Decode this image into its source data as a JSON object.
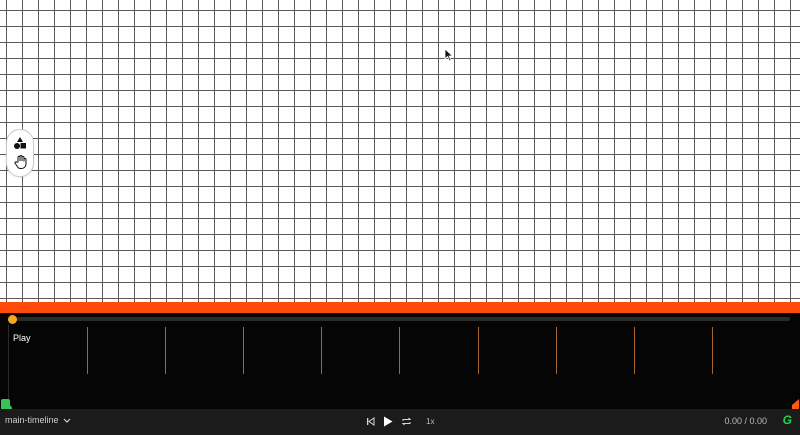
{
  "canvas": {
    "cursor_icon": "arrow-cursor-icon",
    "tools": [
      {
        "name": "shapes-tool",
        "icon": "shapes-icon"
      },
      {
        "name": "hand-tool",
        "icon": "hand-icon"
      }
    ]
  },
  "timeline": {
    "track_label": "Play",
    "accent_color": "#ff4a0a",
    "selector_label": "main-timeline",
    "speed_label": "1x",
    "time_readout": "0.00 / 0.00",
    "brand_letter": "G"
  }
}
